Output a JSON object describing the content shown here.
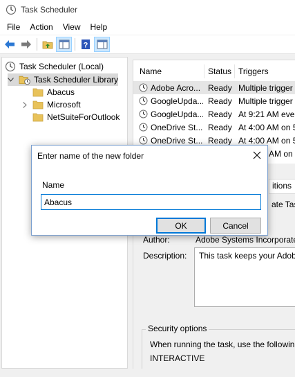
{
  "window": {
    "title": "Task Scheduler",
    "app_icon": "clock-icon"
  },
  "menu": {
    "items": [
      "File",
      "Action",
      "View",
      "Help"
    ]
  },
  "toolbar": {
    "buttons": [
      "back-arrow-icon",
      "forward-arrow-icon",
      "folder-up-icon",
      "show-hide-console-tree-icon",
      "help-icon",
      "show-hide-action-pane-icon"
    ]
  },
  "tree": {
    "root": "Task Scheduler (Local)",
    "library": "Task Scheduler Library",
    "children": [
      "Abacus",
      "Microsoft",
      "NetSuiteForOutlook"
    ]
  },
  "task_list": {
    "columns": [
      "Name",
      "Status",
      "Triggers"
    ],
    "rows": [
      {
        "name": "Adobe Acro...",
        "status": "Ready",
        "triggers": "Multiple trigger"
      },
      {
        "name": "GoogleUpda...",
        "status": "Ready",
        "triggers": "Multiple trigger"
      },
      {
        "name": "GoogleUpda...",
        "status": "Ready",
        "triggers": "At 9:21 AM ever"
      },
      {
        "name": "OneDrive St...",
        "status": "Ready",
        "triggers": "At 4:00 AM on 5"
      },
      {
        "name": "OneDrive St...",
        "status": "Ready",
        "triggers": "At 4:00 AM on 5"
      },
      {
        "name": "",
        "status": "",
        "triggers": "AM on 5"
      }
    ]
  },
  "details": {
    "tab_fragment_1": "itions",
    "tab_fragment_2": "ate Task",
    "author_label": "Author:",
    "author_value": "Adobe Systems Incorporated",
    "description_label": "Description:",
    "description_value": "This task keeps your Adobe",
    "security_legend": "Security options",
    "security_text": "When running the task, use the following",
    "security_account": "INTERACTIVE"
  },
  "dialog": {
    "title": "Enter name of the new folder",
    "name_label": "Name",
    "name_value": "Abacus",
    "ok_label": "OK",
    "cancel_label": "Cancel"
  }
}
